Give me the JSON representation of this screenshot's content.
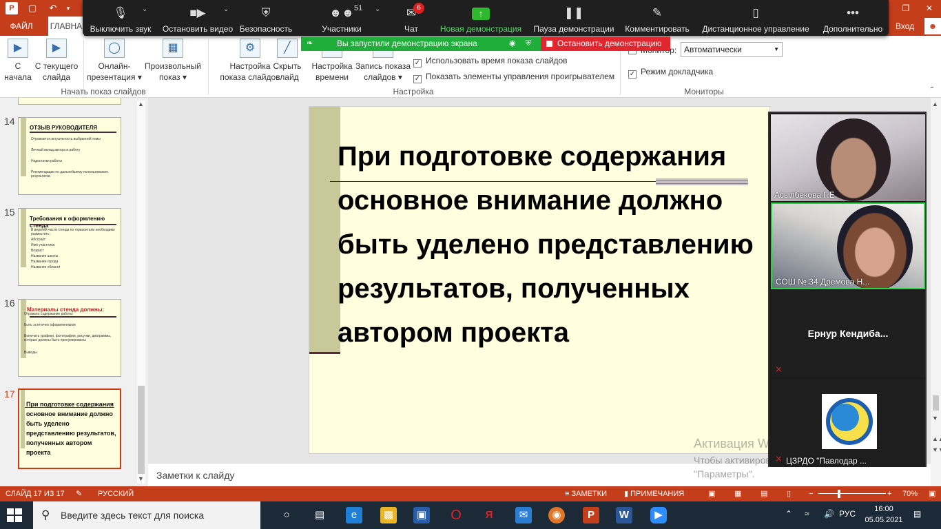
{
  "ribbon_tabs": {
    "file": "ФАЙЛ",
    "home": "ГЛАВНА",
    "signin": "Вход"
  },
  "zoom_toolbar": {
    "mute": "Выключить звук",
    "stop_video": "Остановить видео",
    "security": "Безопасность",
    "participants": "Участники",
    "participants_count": "51",
    "chat": "Чат",
    "chat_badge": "6",
    "new_share": "Новая демонстрация",
    "pause_share": "Пауза демонстрации",
    "annotate": "Комментировать",
    "remote_control": "Дистанционное управление",
    "more": "Дополнительно"
  },
  "share_banner": {
    "text": "Вы запустили демонстрацию экрана",
    "stop": "Остановить демонстрацию"
  },
  "ribbon": {
    "from_start": "С начала",
    "from_start_l1": "С",
    "from_start_l2": "начала",
    "from_current_l1": "С текущего",
    "from_current_l2": "слайда",
    "online_l1": "Онлайн-",
    "online_l2": "презентация",
    "custom_l1": "Произвольный",
    "custom_l2": "показ",
    "group_start": "Начать показ слайдов",
    "setup_l1": "Настройка",
    "setup_l2": "показа слайдов",
    "hide_l1": "Скрыть",
    "hide_l2": "слайд",
    "timing_l1": "Настройка",
    "timing_l2": "времени",
    "record_l1": "Запись показа",
    "record_l2": "слайдов",
    "use_timings": "Использовать время показа слайдов",
    "show_controls": "Показать элементы управления проигрывателем",
    "group_setup": "Настройка",
    "monitor_label": "Монитор:",
    "monitor_value": "Автоматически",
    "presenter_view": "Режим докладчика",
    "group_monitors": "Мониторы"
  },
  "thumbnails": [
    {
      "num": "14",
      "title": "ОТЗЫВ РУКОВОДИТЕЛЯ",
      "lines": [
        "Отражается актуальность выбранной темы",
        "Личный вклад автора в работу",
        "Недостатки работы",
        "Рекомендации по дальнейшему использованию результатов"
      ]
    },
    {
      "num": "15",
      "title": "Требования к оформлению стенда",
      "lines": [
        "В верхней части стенда по горизонтали необходимо разместить:",
        "Абстракт",
        "Имя участника",
        "Возраст",
        "Название школы",
        "Название города",
        "Название области"
      ]
    },
    {
      "num": "16",
      "title": "Материалы стенда должны:",
      "lines": [
        "Отражать содержание работы",
        "Быть эстетично оформленными",
        "Включать графики, фотографии, рисунки, диаграммы, которые должны быть пронумерованы",
        "Выводы"
      ]
    },
    {
      "num": "17",
      "title": "При подготовке содержания основное внимание должно быть уделено представлению результатов, полученных автором проекта"
    }
  ],
  "slide": {
    "title": "При подготовке содержания основное внимание должно быть уделено представлению результатов, полученных автором проекта"
  },
  "notes_placeholder": "Заметки к слайду",
  "video": [
    {
      "name": "Асылбекова Г.Е."
    },
    {
      "name": "СОШ № 34 Дремова Н..."
    },
    {
      "name": "Ернур  Кендиба..."
    },
    {
      "name": "ЦЗРДО \"Павлодар ..."
    }
  ],
  "watermark": {
    "line1": "Активация Windows",
    "line2": "Чтобы активировать Windows, перейдите в раздел \"Параметры\"."
  },
  "status": {
    "slide_info": "СЛАЙД 17 ИЗ 17",
    "language": "РУССКИЙ",
    "notes": "ЗАМЕТКИ",
    "comments": "ПРИМЕЧАНИЯ",
    "zoom": "70%"
  },
  "taskbar": {
    "search_placeholder": "Введите здесь текст для поиска",
    "lang": "РУС",
    "time": "16:00",
    "date": "05.05.2021"
  },
  "colors": {
    "ppt_accent": "#c43e1c",
    "zoom_toolbar": "#1f1f1f",
    "share_green": "#1fae3a",
    "stop_red": "#e0262f",
    "slide_bg": "#ffffdf"
  }
}
